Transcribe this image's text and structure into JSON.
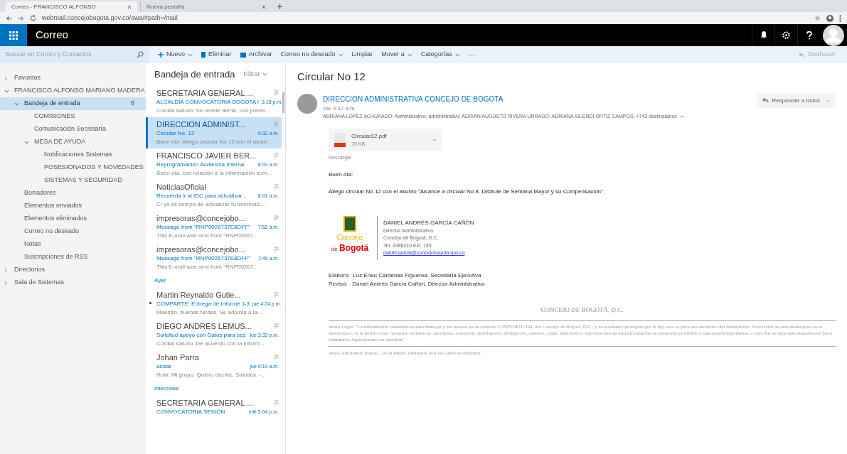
{
  "browser": {
    "tabs": [
      {
        "label": "Correo - FRANCISCO ALFONSO",
        "selected": true
      },
      {
        "label": "Nueva pestaña",
        "selected": false
      }
    ],
    "url": "webmail.concejobogota.gov.co/owa/#path=/mail"
  },
  "app_bar": {
    "title": "Correo"
  },
  "toolbar": {
    "search_placeholder": "Buscar en Correo y Contactos",
    "actions": [
      "Nuevo",
      "Eliminar",
      "Archivar",
      "Correo no deseado",
      "Limpiar",
      "Mover a",
      "Categorías"
    ],
    "more": "···",
    "undo": "Deshacer"
  },
  "folders": [
    {
      "label": "Favoritos",
      "expanded": false,
      "selected": false
    },
    {
      "label": "FRANCISCO ALFONSO MARIANO MADERA",
      "expanded": true,
      "selected": false,
      "children": [
        {
          "label": "Bandeja de entrada",
          "expanded": true,
          "selected": true,
          "count": "8",
          "children": [
            {
              "label": "COMISIONES",
              "selected": false
            },
            {
              "label": "Comunicación Secretaría",
              "selected": false
            },
            {
              "label": "MESA DE AYUDA",
              "expanded": true,
              "selected": false,
              "children": [
                {
                  "label": "Notificaciones Sistemas",
                  "selected": false
                },
                {
                  "label": "POSESIONADOS Y NOVEDADES",
                  "selected": false
                },
                {
                  "label": "SISTEMAS Y SEGURIDAD",
                  "selected": false
                }
              ]
            }
          ]
        },
        {
          "label": "Borradores",
          "selected": false
        },
        {
          "label": "Elementos enviados",
          "selected": false
        },
        {
          "label": "Elementos eliminados",
          "selected": false
        },
        {
          "label": "Correo no deseado",
          "selected": false
        },
        {
          "label": "Notas",
          "selected": false
        },
        {
          "label": "Suscripciones de RSS",
          "selected": false
        }
      ]
    },
    {
      "label": "Directorios",
      "expanded": false,
      "selected": false
    },
    {
      "label": "Sala de Sistemas",
      "expanded": false,
      "selected": false
    }
  ],
  "message_list": {
    "title": "Bandeja de entrada",
    "filter": "Filtrar",
    "items": [
      {
        "kind": "message",
        "sender": "SECRETARIA GENERAL ...",
        "subject": "ALCALDIA CONVOCATORIA BOGOTA I",
        "time": "3:18 p.m.",
        "preview": "Cordial saludo: Se remite alerta, con previo...",
        "selected": false,
        "unread": false
      },
      {
        "kind": "message",
        "sender": "DIRECCION ADMINIST...",
        "subject": "Circular No. 12",
        "time": "9:32 a.m.",
        "preview": "Buen día: Allego circular No 12 con el asunt...",
        "selected": true,
        "unread": false
      },
      {
        "kind": "message",
        "sender": "FRANCISCO JAVIER BER...",
        "subject": "Reprogramación Audiencia Interna",
        "time": "8:43 a.m.",
        "preview": "Buen día, con relación a la información sum...",
        "selected": false,
        "unread": false
      },
      {
        "kind": "message",
        "sender": "NoticiasOficial",
        "subject": "Recuerda ir al IDC para actualizar...",
        "time": "8:01 a.m.",
        "preview": "Ci ya es tiempo de actualizar tu informaci...",
        "selected": false,
        "unread": false
      },
      {
        "kind": "message",
        "sender": "impresoras@concejobo...",
        "subject": "Message from \"RNP0026737E8DFF\"",
        "time": "7:52 a.m.",
        "preview": "This E-mail was sent from \"RNP00267...",
        "selected": false,
        "unread": false
      },
      {
        "kind": "message",
        "sender": "impresoras@concejobo...",
        "subject": "Message from \"RNP0026737E8DFF\"",
        "time": "7:49 a.m.",
        "preview": "This E-mail was sent from \"RNP00267...",
        "selected": false,
        "unread": false
      },
      {
        "kind": "group",
        "label": "Ayer"
      },
      {
        "kind": "message",
        "sender": "Martin Reynaldo Gutie...",
        "subject": "COMPARTE: Entrega de Informe J-3",
        "time": "jue 4:24 p.m.",
        "preview": "Maestro, buenas tardes. Se adjunta a la...",
        "selected": false,
        "unread": true
      },
      {
        "kind": "message",
        "sender": "DIEGO ANDRES LEMUS...",
        "subject": "Solicitud apoyo con Datos para ses",
        "time": "jue 3:33 p.m.",
        "preview": "Cordial saludo. De acuerdo con la inform...",
        "selected": false,
        "unread": false
      },
      {
        "kind": "message",
        "sender": "Johan Parra",
        "subject": "asdas",
        "time": "jue 9:19 a.m.",
        "preview": "Hola. Mi grupo. Quiero decirte, Saludos. -...",
        "selected": false,
        "unread": false
      },
      {
        "kind": "group",
        "label": "miércoles"
      },
      {
        "kind": "message",
        "sender": "SECRETARIA GENERAL ...",
        "subject": "CONVOCATORIA SESIÓN",
        "time": "mié 5:04 p.m.",
        "selected": false,
        "unread": false
      }
    ]
  },
  "reading_pane": {
    "subject": "Circular No 12",
    "sender": "DIRECCION ADMINISTRATIVA CONCEJO DE BOGOTA",
    "time": "Vie 9:32 a.m.",
    "recipients": "ADRIANA LOPEZ ACHURADO; Administrativo; administrativo; ADRIAN AUGUSTO RIVERA URRAGO; ADRIANA SILENDI ORTIZ CAMPOS; +743 destinatarios",
    "reply_all": "Responder a todos",
    "attachment": {
      "name": "Circular12.pdf",
      "size": "75 KB"
    },
    "download": "Descargar",
    "greeting": "Buen día:",
    "body": "Allego circular No 12 con el asunto \"Alcance a circular No 8. Disfrute de Semana Mayor y su Compensación\"",
    "logo": {
      "line1": "Concejo",
      "line2": "de",
      "line3": "Bogotá"
    },
    "signature": [
      "DANIEL ANDRÉS GARCÍA CAÑÓN",
      "Director Administrativo",
      "Concejo de Bogotá, D.C.",
      "Tel. 2088210 Ext. 745"
    ],
    "signature_email": "daniel.garcia@concejobogota.gov.co",
    "credits": [
      "Elaboró:  Luz Eneu Cárdenas Figueroa. Secretaria Ejecutiva",
      "Revisó:   Daniel Andrés García Cañón. Director Administrativo"
    ],
    "footer_title": "CONCEJO DE BOGOTÁ, D.C.",
    "disclaimer": "Aviso Legal: \"La información contenida en este mensaje y sus anexos es de carácter CONFIDENCIAL del Concejo de Bogotá, D.C., y se encuentra protegida por la ley, solo es para uso exclusivo del destinatario. Si el lector de este mensaje no es el destinatario, se le notifica que cualquier revisión no autorizada, retención, distribución, divulgación, reenvío, copia, impresión o reproducción de esta información se encuentra prohibida y sancionada legalmente, a cuyo fin se debe este mensaje por favor eliminarlo. Agradecemos su atención\"",
    "eco_note": "Aviso Ambiental: Piense... en el Medio Ambiente. Por eso antes de imprimir."
  }
}
